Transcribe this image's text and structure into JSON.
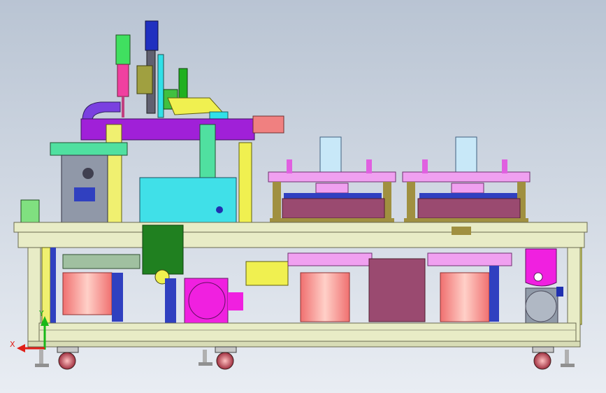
{
  "viewport": {
    "background_top": "#b9c4d3",
    "background_bottom": "#e9edf3"
  },
  "triad": {
    "x_label": "X",
    "y_label": "Y",
    "x_color": "#e0201a",
    "y_color": "#18b818"
  },
  "palette": {
    "frame": "#e8ecc6",
    "frame_dark": "#7a7a60",
    "purple": "#a020d8",
    "magenta": "#f020e0",
    "cyan": "#30e0e8",
    "yellow": "#f0f050",
    "salmon": "#f8a898",
    "pink": "#f0a0e8",
    "navy": "#2020a0",
    "olive": "#a09040",
    "green": "#209020",
    "blue": "#3040c0",
    "gray": "#9098a8",
    "orange": "#f08080"
  }
}
